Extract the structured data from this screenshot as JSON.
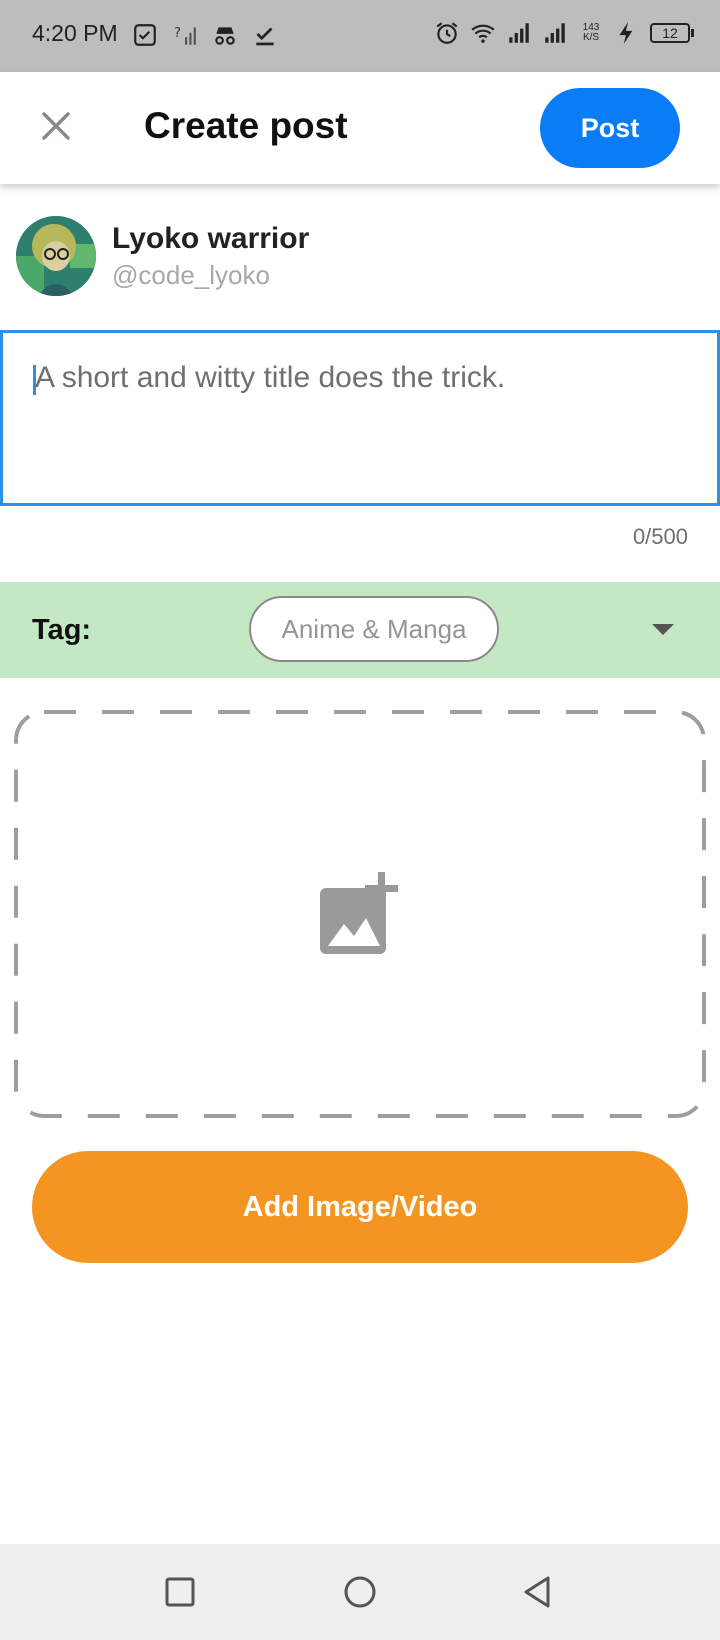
{
  "status_bar": {
    "time": "4:20 PM",
    "left_icons": [
      "checkbox-icon",
      "signal-off-icon",
      "incognito-icon",
      "download-done-icon"
    ],
    "right_icons": [
      "alarm-icon",
      "wifi-icon",
      "signal-icon",
      "signal-icon"
    ],
    "net_speed_value": "143",
    "net_speed_unit": "K/S",
    "battery_level": "12"
  },
  "app_bar": {
    "close_icon": "close-icon",
    "title": "Create post",
    "post_label": "Post"
  },
  "user": {
    "name": "Lyoko warrior",
    "handle": "@code_lyoko"
  },
  "title_input": {
    "placeholder": "A short and witty title does the trick.",
    "value": "",
    "counter": "0/500"
  },
  "tag": {
    "label": "Tag:",
    "selected": "Anime & Manga"
  },
  "upload": {
    "icon": "add-photo-icon"
  },
  "add_media_label": "Add Image/Video",
  "nav_bar": {
    "items": [
      "recents-icon",
      "home-icon",
      "back-icon"
    ]
  },
  "colors": {
    "post_button": "#0a7cf5",
    "tag_bar": "#c3e8c3",
    "add_button": "#f59521",
    "input_border": "#2d8fe6"
  }
}
